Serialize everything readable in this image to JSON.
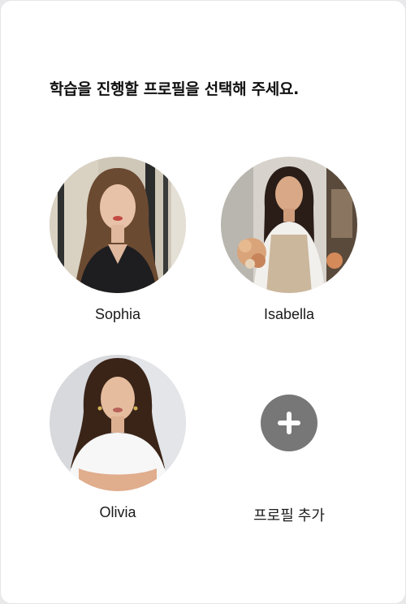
{
  "heading": "학습을 진행할 프로필을 선택해 주세요.",
  "profiles": [
    {
      "name": "Sophia",
      "icon": "profile-photo"
    },
    {
      "name": "Isabella",
      "icon": "profile-photo"
    },
    {
      "name": "Olivia",
      "icon": "profile-photo"
    }
  ],
  "add_profile": {
    "label": "프로필 추가",
    "icon": "plus-icon"
  },
  "colors": {
    "background": "#ffffff",
    "text": "#111111",
    "add_button": "#777777"
  }
}
